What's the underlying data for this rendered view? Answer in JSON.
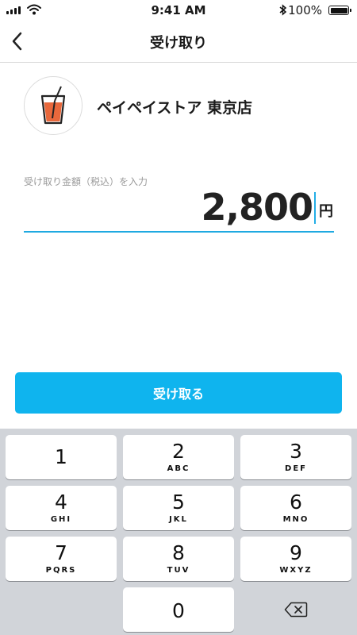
{
  "status_bar": {
    "time": "9:41 AM",
    "battery_text": "100%",
    "icons": [
      "signal-icon",
      "wifi-icon",
      "bluetooth-icon",
      "battery-icon"
    ]
  },
  "nav": {
    "title": "受け取り",
    "back_icon": "chevron-left-icon"
  },
  "store": {
    "name": "ペイペイストア 東京店",
    "logo_icon": "drink-cup-icon"
  },
  "amount": {
    "label": "受け取り金額（税込）を入力",
    "value": "2,800",
    "unit": "円"
  },
  "receive_button": {
    "label": "受け取る"
  },
  "keypad": {
    "keys": [
      {
        "num": "1",
        "letters": ""
      },
      {
        "num": "2",
        "letters": "ABC"
      },
      {
        "num": "3",
        "letters": "DEF"
      },
      {
        "num": "4",
        "letters": "GHI"
      },
      {
        "num": "5",
        "letters": "JKL"
      },
      {
        "num": "6",
        "letters": "MNO"
      },
      {
        "num": "7",
        "letters": "PQRS"
      },
      {
        "num": "8",
        "letters": "TUV"
      },
      {
        "num": "9",
        "letters": "WXYZ"
      },
      {
        "num": "0",
        "letters": ""
      }
    ],
    "delete_icon": "backspace-icon"
  },
  "colors": {
    "accent": "#0fb4ee",
    "keypad_bg": "#d1d4d9",
    "logo_cup": "#e8683c"
  }
}
